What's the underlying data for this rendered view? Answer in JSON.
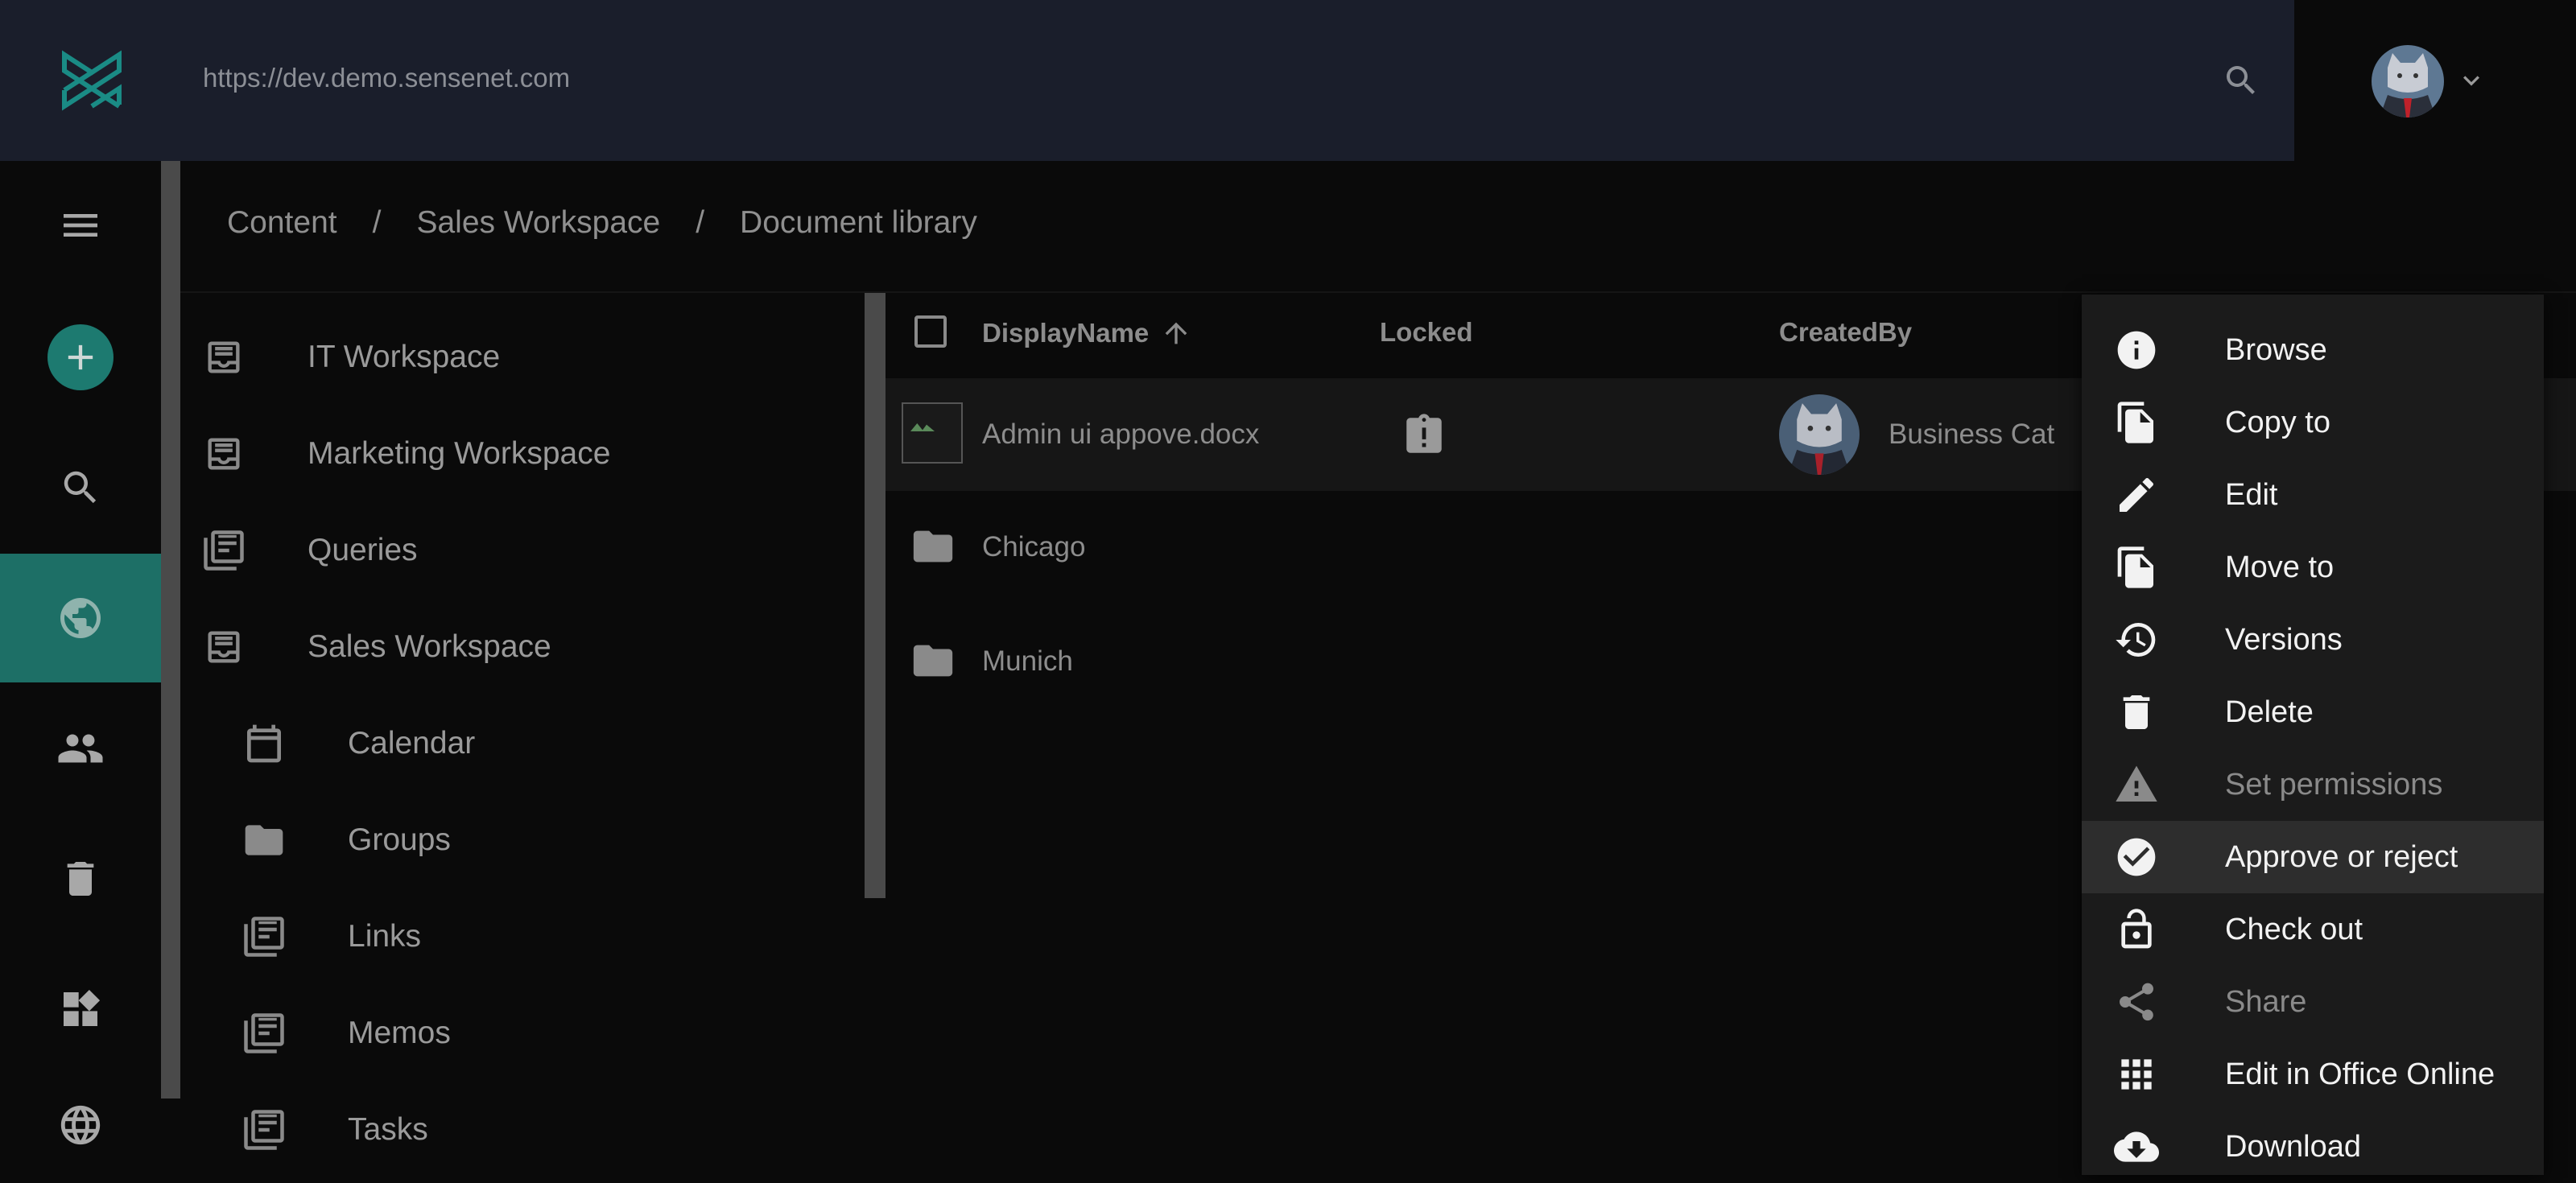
{
  "header": {
    "url": "https://dev.demo.sensenet.com"
  },
  "rail": {
    "items": [
      {
        "icon": "menu-icon"
      },
      {
        "icon": "add-icon"
      },
      {
        "icon": "search-icon"
      },
      {
        "icon": "globe-icon",
        "active": true
      },
      {
        "icon": "users-icon"
      },
      {
        "icon": "trash-icon"
      },
      {
        "icon": "widgets-icon"
      },
      {
        "icon": "language-icon"
      }
    ]
  },
  "breadcrumb": {
    "items": [
      "Content",
      "Sales Workspace",
      "Document library"
    ],
    "separator": "/"
  },
  "tree": {
    "items": [
      {
        "label": "IT Workspace",
        "icon": "workspace-icon",
        "level": 0
      },
      {
        "label": "Marketing Workspace",
        "icon": "workspace-icon",
        "level": 0
      },
      {
        "label": "Queries",
        "icon": "list-icon",
        "level": 0
      },
      {
        "label": "Sales Workspace",
        "icon": "workspace-icon",
        "level": 0
      },
      {
        "label": "Calendar",
        "icon": "calendar-icon",
        "level": 1
      },
      {
        "label": "Groups",
        "icon": "folder-icon",
        "level": 1
      },
      {
        "label": "Links",
        "icon": "list-icon",
        "level": 1
      },
      {
        "label": "Memos",
        "icon": "list-icon",
        "level": 1
      },
      {
        "label": "Tasks",
        "icon": "list-icon",
        "level": 1
      }
    ]
  },
  "table": {
    "columns": {
      "display_name": "DisplayName",
      "locked": "Locked",
      "created_by": "CreatedBy"
    },
    "rows": [
      {
        "name": "Admin ui appove.docx",
        "locked_icon": "lock-clipboard-icon",
        "created_by": "Business Cat",
        "selected": true
      },
      {
        "name": "Chicago",
        "icon": "folder-icon"
      },
      {
        "name": "Munich",
        "icon": "folder-icon"
      }
    ]
  },
  "context_menu": {
    "items": [
      {
        "label": "Browse",
        "icon": "info-icon"
      },
      {
        "label": "Copy to",
        "icon": "copy-icon"
      },
      {
        "label": "Edit",
        "icon": "pencil-icon"
      },
      {
        "label": "Move to",
        "icon": "move-icon"
      },
      {
        "label": "Versions",
        "icon": "history-icon"
      },
      {
        "label": "Delete",
        "icon": "trash-icon"
      },
      {
        "label": "Set permissions",
        "icon": "warning-icon",
        "disabled": true
      },
      {
        "label": "Approve or reject",
        "icon": "check-circle-icon",
        "highlighted": true
      },
      {
        "label": "Check out",
        "icon": "lock-open-icon"
      },
      {
        "label": "Share",
        "icon": "share-icon",
        "disabled": true
      },
      {
        "label": "Edit in Office Online",
        "icon": "apps-icon"
      },
      {
        "label": "Download",
        "icon": "cloud-download-icon"
      }
    ]
  },
  "colors": {
    "topbar": "#1a1e2b",
    "accent": "#1d7a70",
    "background": "#0a0a0a",
    "menu": "#1b1b1b"
  }
}
